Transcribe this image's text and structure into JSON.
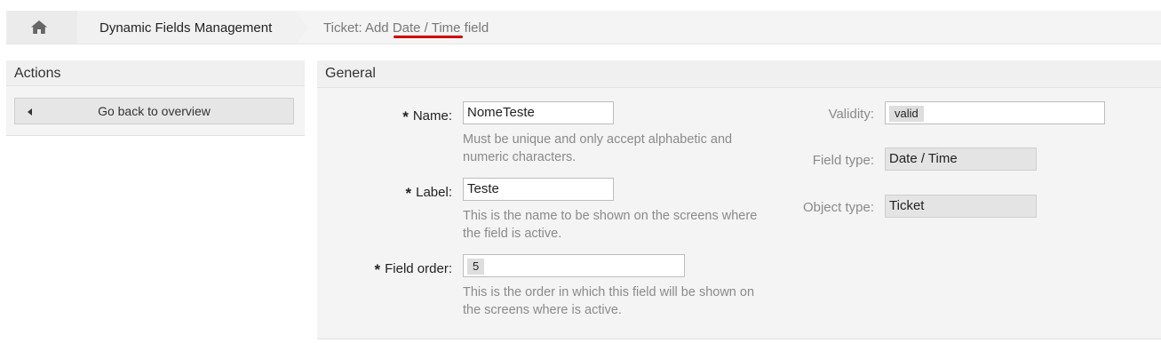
{
  "breadcrumb": {
    "home_icon": "home-icon",
    "item1": "Dynamic Fields Management",
    "current_prefix": "Ticket: Add ",
    "current_highlight": "Date / Time",
    "current_suffix": " field"
  },
  "actions": {
    "title": "Actions",
    "back_button": "Go back to overview"
  },
  "general": {
    "title": "General",
    "name": {
      "label": "Name:",
      "value": "NomeTeste",
      "hint": "Must be unique and only accept alphabetic and numeric characters."
    },
    "label": {
      "label": "Label:",
      "value": "Teste",
      "hint": "This is the name to be shown on the screens where the field is active."
    },
    "field_order": {
      "label": "Field order:",
      "value": "5",
      "hint": "This is the order in which this field will be shown on the screens where is active."
    },
    "validity": {
      "label": "Validity:",
      "value": "valid"
    },
    "field_type": {
      "label": "Field type:",
      "value": "Date / Time"
    },
    "object_type": {
      "label": "Object type:",
      "value": "Ticket"
    },
    "required_marker": "*"
  },
  "colors": {
    "annotation_underline": "#d00000"
  }
}
